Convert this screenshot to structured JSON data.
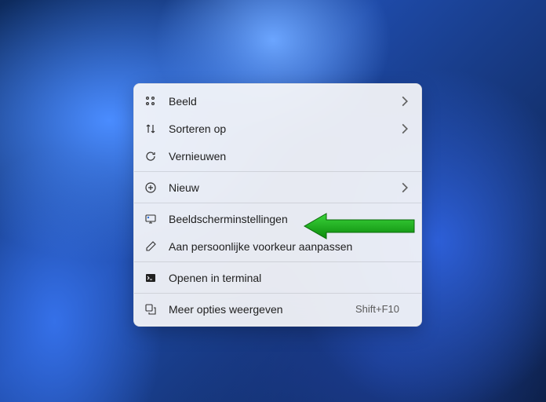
{
  "menu": {
    "items": [
      {
        "label": "Beeld",
        "icon": "view-icon",
        "hasSubmenu": true
      },
      {
        "label": "Sorteren op",
        "icon": "sort-icon",
        "hasSubmenu": true
      },
      {
        "label": "Vernieuwen",
        "icon": "refresh-icon",
        "hasSubmenu": false
      },
      {
        "label": "Nieuw",
        "icon": "new-icon",
        "hasSubmenu": true
      },
      {
        "label": "Beeldscherminstellingen",
        "icon": "display-settings-icon",
        "hasSubmenu": false
      },
      {
        "label": "Aan persoonlijke voorkeur aanpassen",
        "icon": "personalize-icon",
        "hasSubmenu": false
      },
      {
        "label": "Openen in terminal",
        "icon": "terminal-icon",
        "hasSubmenu": false
      },
      {
        "label": "Meer opties weergeven",
        "icon": "more-options-icon",
        "hasSubmenu": false,
        "shortcut": "Shift+F10"
      }
    ]
  },
  "annotation": {
    "arrow_color": "#1fa81f",
    "target_index": 4
  }
}
